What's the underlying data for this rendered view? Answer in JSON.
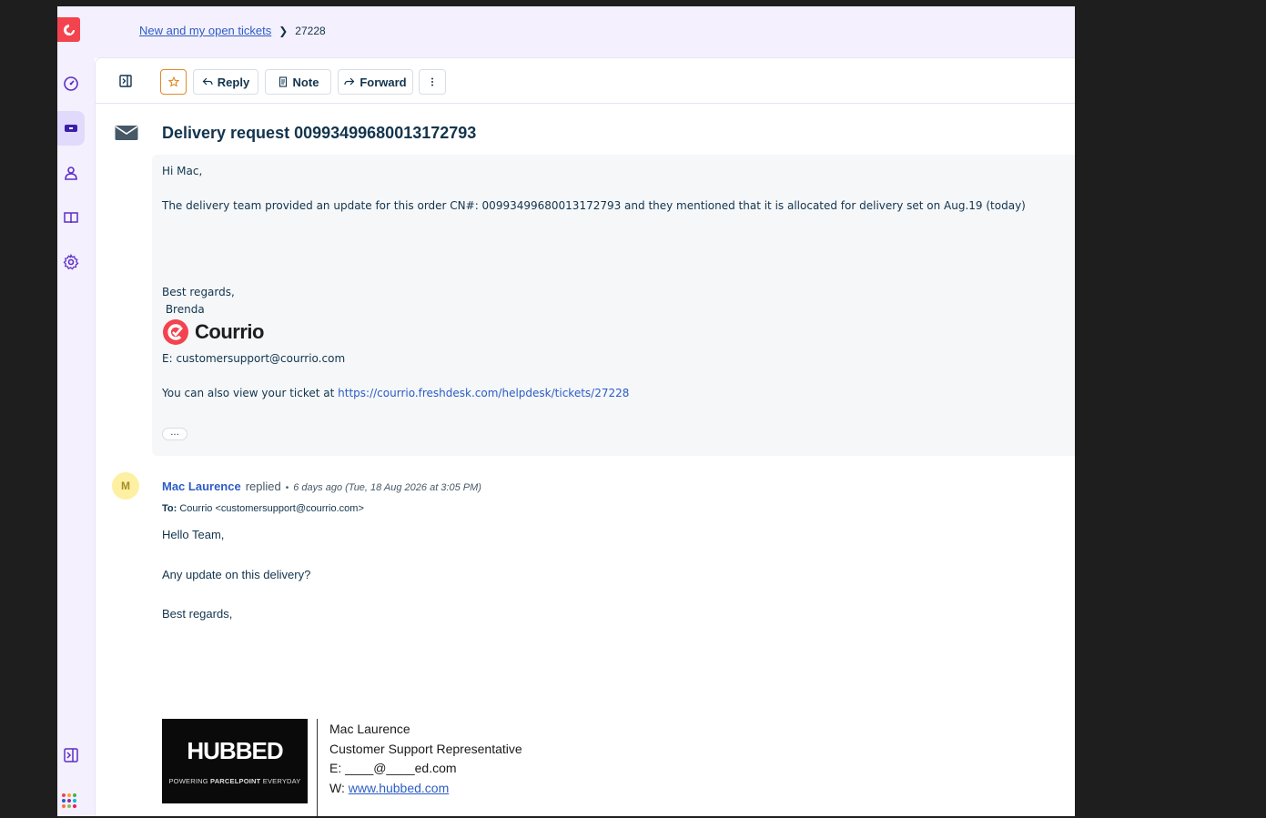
{
  "breadcrumb": {
    "parent": "New and my open tickets",
    "current": "27228"
  },
  "toolbar": {
    "reply": "Reply",
    "note": "Note",
    "forward": "Forward"
  },
  "ticket": {
    "subject": "Delivery request 00993499680013172793"
  },
  "quoted_message": {
    "greeting": "Hi Mac,",
    "body": "The delivery team provided an update for this order CN#: 00993499680013172793 and they mentioned that it is allocated for delivery set on Aug.19 (today)",
    "regards": "Best regards,",
    "signer": " Brenda",
    "brand_name": "Courrio",
    "email_line": "E: customersupport@courrio.com",
    "view_prefix": "You can also view your ticket at ",
    "view_link": "https://courrio.freshdesk.com/helpdesk/tickets/27228",
    "more": "..."
  },
  "reply": {
    "avatar_letter": "M",
    "author": "Mac Laurence",
    "verb": "replied",
    "separator": "•",
    "time": "6 days ago (Tue, 18 Aug 2026 at 3:05 PM)",
    "to_label": "To:",
    "to_value": "Courrio <customersupport@courrio.com>",
    "greeting": "Hello Team,",
    "body": "Any update on this delivery?",
    "regards": "Best regards,"
  },
  "signature": {
    "logo_big": "HUBBED",
    "logo_small_prefix": "POWERING ",
    "logo_small_bold": "PARCELPOINT",
    "logo_small_suffix": " EVERYDAY",
    "name": "Mac Laurence",
    "title": "Customer Support Representative",
    "email_partial": "E: ____@____ed.com",
    "web_label": "W: ",
    "web_link": "www.hubbed.com"
  },
  "colors": {
    "rail_bg": "#f4f0fd",
    "accent_link": "#2c5cc5",
    "brand_red": "#f3434f",
    "star_orange": "#e08a2a",
    "avatar_bg": "#fdf0a3"
  }
}
